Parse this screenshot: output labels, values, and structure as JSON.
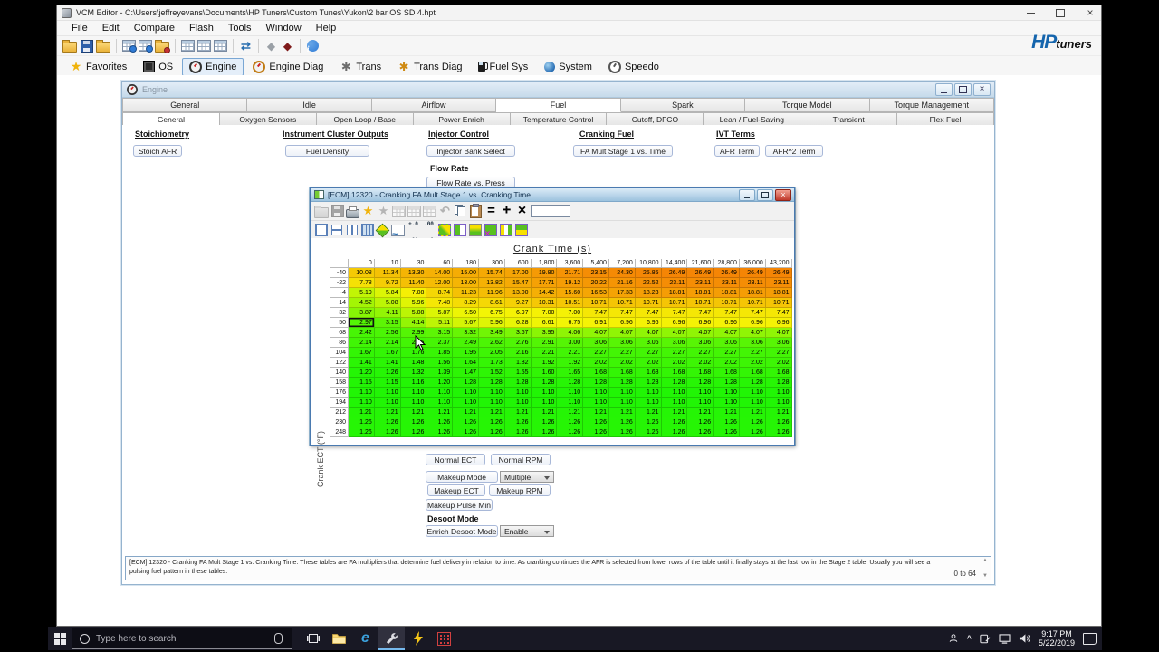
{
  "window": {
    "title": "VCM Editor - C:\\Users\\jeffreyevans\\Documents\\HP Tuners\\Custom Tunes\\Yukon\\2 bar OS SD 4.hpt"
  },
  "brand": {
    "hp": "HP",
    "tuners": "tuners"
  },
  "menus": [
    "File",
    "Edit",
    "Compare",
    "Flash",
    "Tools",
    "Window",
    "Help"
  ],
  "app_toolbar": [
    "folder",
    "save",
    "folder",
    "|",
    "tableinfo",
    "tableinfo",
    "folderx",
    "|",
    "table",
    "table",
    "table",
    "|",
    "sync",
    "|",
    "diamond-gray",
    "diamond-red",
    "|",
    "info"
  ],
  "nav": [
    {
      "label": "Favorites",
      "icon": "star",
      "active": false
    },
    {
      "label": "OS",
      "icon": "chip",
      "active": false
    },
    {
      "label": "Engine",
      "icon": "gauge",
      "active": true
    },
    {
      "label": "Engine Diag",
      "icon": "gauge-diag",
      "active": false
    },
    {
      "label": "Trans",
      "icon": "gear",
      "active": false
    },
    {
      "label": "Trans Diag",
      "icon": "gear-diag",
      "active": false
    },
    {
      "label": "Fuel Sys",
      "icon": "fuel",
      "active": false
    },
    {
      "label": "System",
      "icon": "globe",
      "active": false
    },
    {
      "label": "Speedo",
      "icon": "speedo",
      "active": false
    }
  ],
  "engine_window": {
    "title": "Engine",
    "tabs_row1": [
      "General",
      "Idle",
      "Airflow",
      "Fuel",
      "Spark",
      "Torque Model",
      "Torque Management"
    ],
    "tabs_row1_active": 3,
    "tabs_row2": [
      "General",
      "Oxygen Sensors",
      "Open Loop / Base",
      "Power Enrich",
      "Temperature Control",
      "Cutoff, DFCO",
      "Lean / Fuel-Saving",
      "Transient",
      "Flex Fuel"
    ],
    "tabs_row2_active": 0,
    "sections": {
      "stoichiometry_header": "Stoichiometry",
      "stoich_afr": "Stoich AFR",
      "instrument_header": "Instrument Cluster Outputs",
      "fuel_density": "Fuel Density",
      "injector_header": "Injector Control",
      "injector_bank_select": "Injector Bank Select",
      "flow_rate_header": "Flow Rate",
      "flow_rate_vs_press": "Flow Rate vs. Press",
      "cranking_header": "Cranking Fuel",
      "fa_mult_stage1": "FA Mult Stage 1 vs. Time",
      "ivt_header": "IVT Terms",
      "afr_term": "AFR Term",
      "afr2_term": "AFR^2 Term"
    },
    "controls": {
      "normal_ect": "Normal ECT",
      "normal_rpm": "Normal RPM",
      "makeup_mode": "Makeup Mode",
      "makeup_mode_value": "Multiple",
      "makeup_ect": "Makeup ECT",
      "makeup_rpm": "Makeup RPM",
      "makeup_pulse_min": "Makeup Pulse Min",
      "desoot_header": "Desoot Mode",
      "enrich_desoot_mode": "Enrich Desoot Mode",
      "enrich_desoot_value": "Enable"
    },
    "status_text": "[ECM] 12320 - Cranking FA Mult Stage 1 vs. Cranking Time: These tables are FA multipliers that determine fuel delivery in relation to time. As cranking continues the AFR is selected from lower rows of the table until it finally stays at the last row in the Stage 2 table. Usually you will see a pulsing fuel pattern in these tables.",
    "status_range": "0 to 64"
  },
  "table_window": {
    "title": "[ECM] 12320 - Cranking FA Mult Stage 1 vs. Cranking Time",
    "toolbar_row1": [
      "folder:dis",
      "save:dis",
      "print",
      "star-gold",
      "star-gray",
      "table:dis",
      "table:dis",
      "table:dis",
      "undo:dis",
      "copy",
      "paste",
      "eq",
      "plus",
      "times",
      "input"
    ],
    "toolbar_row2": [
      "view1",
      "view2",
      "view3",
      "view4",
      "3d",
      "chart",
      "dec1",
      "dec2",
      "m1",
      "m2",
      "m3",
      "m4",
      "m5",
      "m6"
    ],
    "x_axis_title": "Crank Time (s)",
    "y_axis_title": "Crank ECT (°F)",
    "columns": [
      "0",
      "10",
      "30",
      "60",
      "180",
      "300",
      "600",
      "1,800",
      "3,600",
      "5,400",
      "7,200",
      "10,800",
      "14,400",
      "21,600",
      "28,800",
      "36,000",
      "43,200"
    ],
    "rows": [
      {
        "label": "-40",
        "values": [
          10.08,
          11.34,
          13.3,
          14.0,
          15.0,
          15.74,
          17.0,
          19.8,
          21.71,
          23.15,
          24.3,
          25.85,
          26.49,
          26.49,
          26.49,
          26.49,
          26.49
        ]
      },
      {
        "label": "-22",
        "values": [
          7.78,
          9.72,
          11.4,
          12.0,
          13.0,
          13.82,
          15.47,
          17.71,
          19.12,
          20.22,
          21.16,
          22.52,
          23.11,
          23.11,
          23.11,
          23.11,
          23.11
        ]
      },
      {
        "label": "-4",
        "values": [
          5.19,
          5.84,
          7.08,
          8.74,
          11.23,
          11.96,
          13.0,
          14.42,
          15.6,
          16.53,
          17.33,
          18.23,
          18.81,
          18.81,
          18.81,
          18.81,
          18.81
        ]
      },
      {
        "label": "14",
        "values": [
          4.52,
          5.08,
          5.96,
          7.48,
          8.29,
          8.61,
          9.27,
          10.31,
          10.51,
          10.71,
          10.71,
          10.71,
          10.71,
          10.71,
          10.71,
          10.71,
          10.71
        ]
      },
      {
        "label": "32",
        "values": [
          3.87,
          4.11,
          5.08,
          5.87,
          6.5,
          6.75,
          6.97,
          7.0,
          7.0,
          7.47,
          7.47,
          7.47,
          7.47,
          7.47,
          7.47,
          7.47,
          7.47
        ]
      },
      {
        "label": "50",
        "values": [
          2.97,
          3.15,
          4.14,
          5.11,
          5.67,
          5.96,
          6.28,
          6.61,
          6.75,
          6.91,
          6.96,
          6.96,
          6.96,
          6.96,
          6.96,
          6.96,
          6.96
        ]
      },
      {
        "label": "68",
        "values": [
          2.42,
          2.56,
          2.99,
          3.15,
          3.32,
          3.49,
          3.67,
          3.95,
          4.06,
          4.07,
          4.07,
          4.07,
          4.07,
          4.07,
          4.07,
          4.07,
          4.07
        ]
      },
      {
        "label": "86",
        "values": [
          2.14,
          2.14,
          2.25,
          2.37,
          2.49,
          2.62,
          2.76,
          2.91,
          3.0,
          3.06,
          3.06,
          3.06,
          3.06,
          3.06,
          3.06,
          3.06,
          3.06
        ]
      },
      {
        "label": "104",
        "values": [
          1.67,
          1.67,
          1.76,
          1.85,
          1.95,
          2.05,
          2.16,
          2.21,
          2.21,
          2.27,
          2.27,
          2.27,
          2.27,
          2.27,
          2.27,
          2.27,
          2.27
        ]
      },
      {
        "label": "122",
        "values": [
          1.41,
          1.41,
          1.48,
          1.56,
          1.64,
          1.73,
          1.82,
          1.92,
          1.92,
          2.02,
          2.02,
          2.02,
          2.02,
          2.02,
          2.02,
          2.02,
          2.02
        ]
      },
      {
        "label": "140",
        "values": [
          1.2,
          1.26,
          1.32,
          1.39,
          1.47,
          1.52,
          1.55,
          1.6,
          1.65,
          1.68,
          1.68,
          1.68,
          1.68,
          1.68,
          1.68,
          1.68,
          1.68
        ]
      },
      {
        "label": "158",
        "values": [
          1.15,
          1.15,
          1.16,
          1.2,
          1.28,
          1.28,
          1.28,
          1.28,
          1.28,
          1.28,
          1.28,
          1.28,
          1.28,
          1.28,
          1.28,
          1.28,
          1.28
        ]
      },
      {
        "label": "176",
        "values": [
          1.1,
          1.1,
          1.1,
          1.1,
          1.1,
          1.1,
          1.1,
          1.1,
          1.1,
          1.1,
          1.1,
          1.1,
          1.1,
          1.1,
          1.1,
          1.1,
          1.1
        ]
      },
      {
        "label": "194",
        "values": [
          1.1,
          1.1,
          1.1,
          1.1,
          1.1,
          1.1,
          1.1,
          1.1,
          1.1,
          1.1,
          1.1,
          1.1,
          1.1,
          1.1,
          1.1,
          1.1,
          1.1
        ]
      },
      {
        "label": "212",
        "values": [
          1.21,
          1.21,
          1.21,
          1.21,
          1.21,
          1.21,
          1.21,
          1.21,
          1.21,
          1.21,
          1.21,
          1.21,
          1.21,
          1.21,
          1.21,
          1.21,
          1.21
        ]
      },
      {
        "label": "230",
        "values": [
          1.26,
          1.26,
          1.26,
          1.26,
          1.26,
          1.26,
          1.26,
          1.26,
          1.26,
          1.26,
          1.26,
          1.26,
          1.26,
          1.26,
          1.26,
          1.26,
          1.26
        ]
      },
      {
        "label": "248",
        "values": [
          1.26,
          1.26,
          1.26,
          1.26,
          1.26,
          1.26,
          1.26,
          1.26,
          1.26,
          1.26,
          1.26,
          1.26,
          1.26,
          1.26,
          1.26,
          1.26,
          1.26
        ]
      }
    ],
    "selected_cell": {
      "row": 5,
      "col": 0
    },
    "value_min": 1.1,
    "value_max": 26.49
  },
  "colors": {
    "hp_blue": "#1565ad",
    "cell_green": "#2bd40a",
    "cell_yellow": "#f7dd06",
    "cell_orange": "#f58b06",
    "active_titlebar": "#9cc2de",
    "close_red": "#c0392b",
    "taskbar_bg": "#181824"
  },
  "taskbar": {
    "search_placeholder": "Type here to search",
    "time": "9:17 PM",
    "date": "5/22/2019"
  }
}
